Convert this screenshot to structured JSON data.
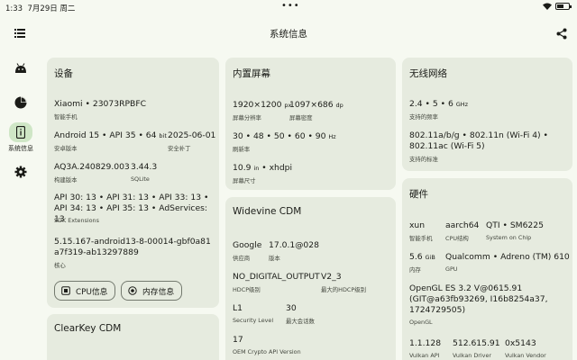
{
  "status_bar": {
    "time": "1:33",
    "date": "7月29日 周二",
    "dots": "•••"
  },
  "app_bar": {
    "title": "系统信息"
  },
  "rail": {
    "system_info_label": "系统信息"
  },
  "device": {
    "title": "设备",
    "model": "Xiaomi • 23073RPBFC",
    "model_label": "智能手机",
    "android": "Android 15 • API 35 • 64",
    "android_suffix": "bit",
    "android_label": "安卓版本",
    "patch": "2025-06-01",
    "patch_label": "安全补丁",
    "build": "AQ3A.240829.003",
    "build_label": "构建版本",
    "sqlite": "3.44.3",
    "sqlite_label": "SQLite",
    "sdk_ext": "API 30: 13 • API 31: 13 • API 33: 13 • API 34: 13 • API 35: 13 • AdServices: 13",
    "sdk_ext_label": "SDK Extensions",
    "kernel": "5.15.167-android13-8-00014-gbf0a81a7f319-ab13297889",
    "kernel_label": "核心",
    "cpu_button": "CPU信息",
    "mem_button": "内存信息"
  },
  "display": {
    "title": "内置屏幕",
    "resolution": "1920×1200",
    "resolution_unit": "px",
    "resolution_label": "屏幕分辨率",
    "density": "1097×686",
    "density_unit": "dp",
    "density_label": "屏幕密度",
    "refresh": "30 • 48 • 50 • 60 • 90",
    "refresh_unit": "Hz",
    "refresh_label": "刷新率",
    "size": "10.9",
    "size_unit": "in",
    "size_dpi": "• xhdpi",
    "size_label": "屏幕尺寸"
  },
  "widevine": {
    "title": "Widevine CDM",
    "vendor": "Google",
    "vendor_label": "供应商",
    "version": "17.0.1@028",
    "version_label": "版本",
    "hdcp": "NO_DIGITAL_OUTPUT",
    "hdcp_label": "HDCP级别",
    "max_hdcp": "V2_3",
    "max_hdcp_label": "最大的HDCP级别",
    "security": "L1",
    "security_label": "Security Level",
    "sessions": "30",
    "sessions_label": "最大会话数",
    "oem": "17",
    "oem_label": "OEM Crypto API Version"
  },
  "clearkey": {
    "title": "ClearKey CDM"
  },
  "wifi": {
    "title": "无线网络",
    "freq": "2.4 • 5 • 6",
    "freq_unit": "GHz",
    "freq_label": "支持的频率",
    "standards": "802.11a/b/g • 802.11n (Wi-Fi 4) • 802.11ac (Wi-Fi 5)",
    "standards_label": "支持的标准"
  },
  "hardware": {
    "title": "硬件",
    "brand": "xun",
    "brand_label": "智能手机",
    "abi": "aarch64",
    "abi_label": "CPU结构",
    "soc": "QTI • SM6225",
    "soc_label": "System on Chip",
    "ram": "5.6",
    "ram_unit": "GiB",
    "ram_label": "内存",
    "gpu": "Qualcomm • Adreno (TM) 610",
    "gpu_label": "GPU",
    "opengl": "OpenGL ES 3.2 V@0615.91 (GIT@a63fb93269, I16b8254a37, 1724729505)",
    "opengl_label": "OpenGL",
    "vulkan_api": "1.1.128",
    "vulkan_api_label": "Vulkan API",
    "vulkan_driver": "512.615.91",
    "vulkan_driver_label": "Vulkan Driver",
    "vulkan_vendor": "0x5143",
    "vulkan_vendor_label": "Vulkan Vendor"
  }
}
